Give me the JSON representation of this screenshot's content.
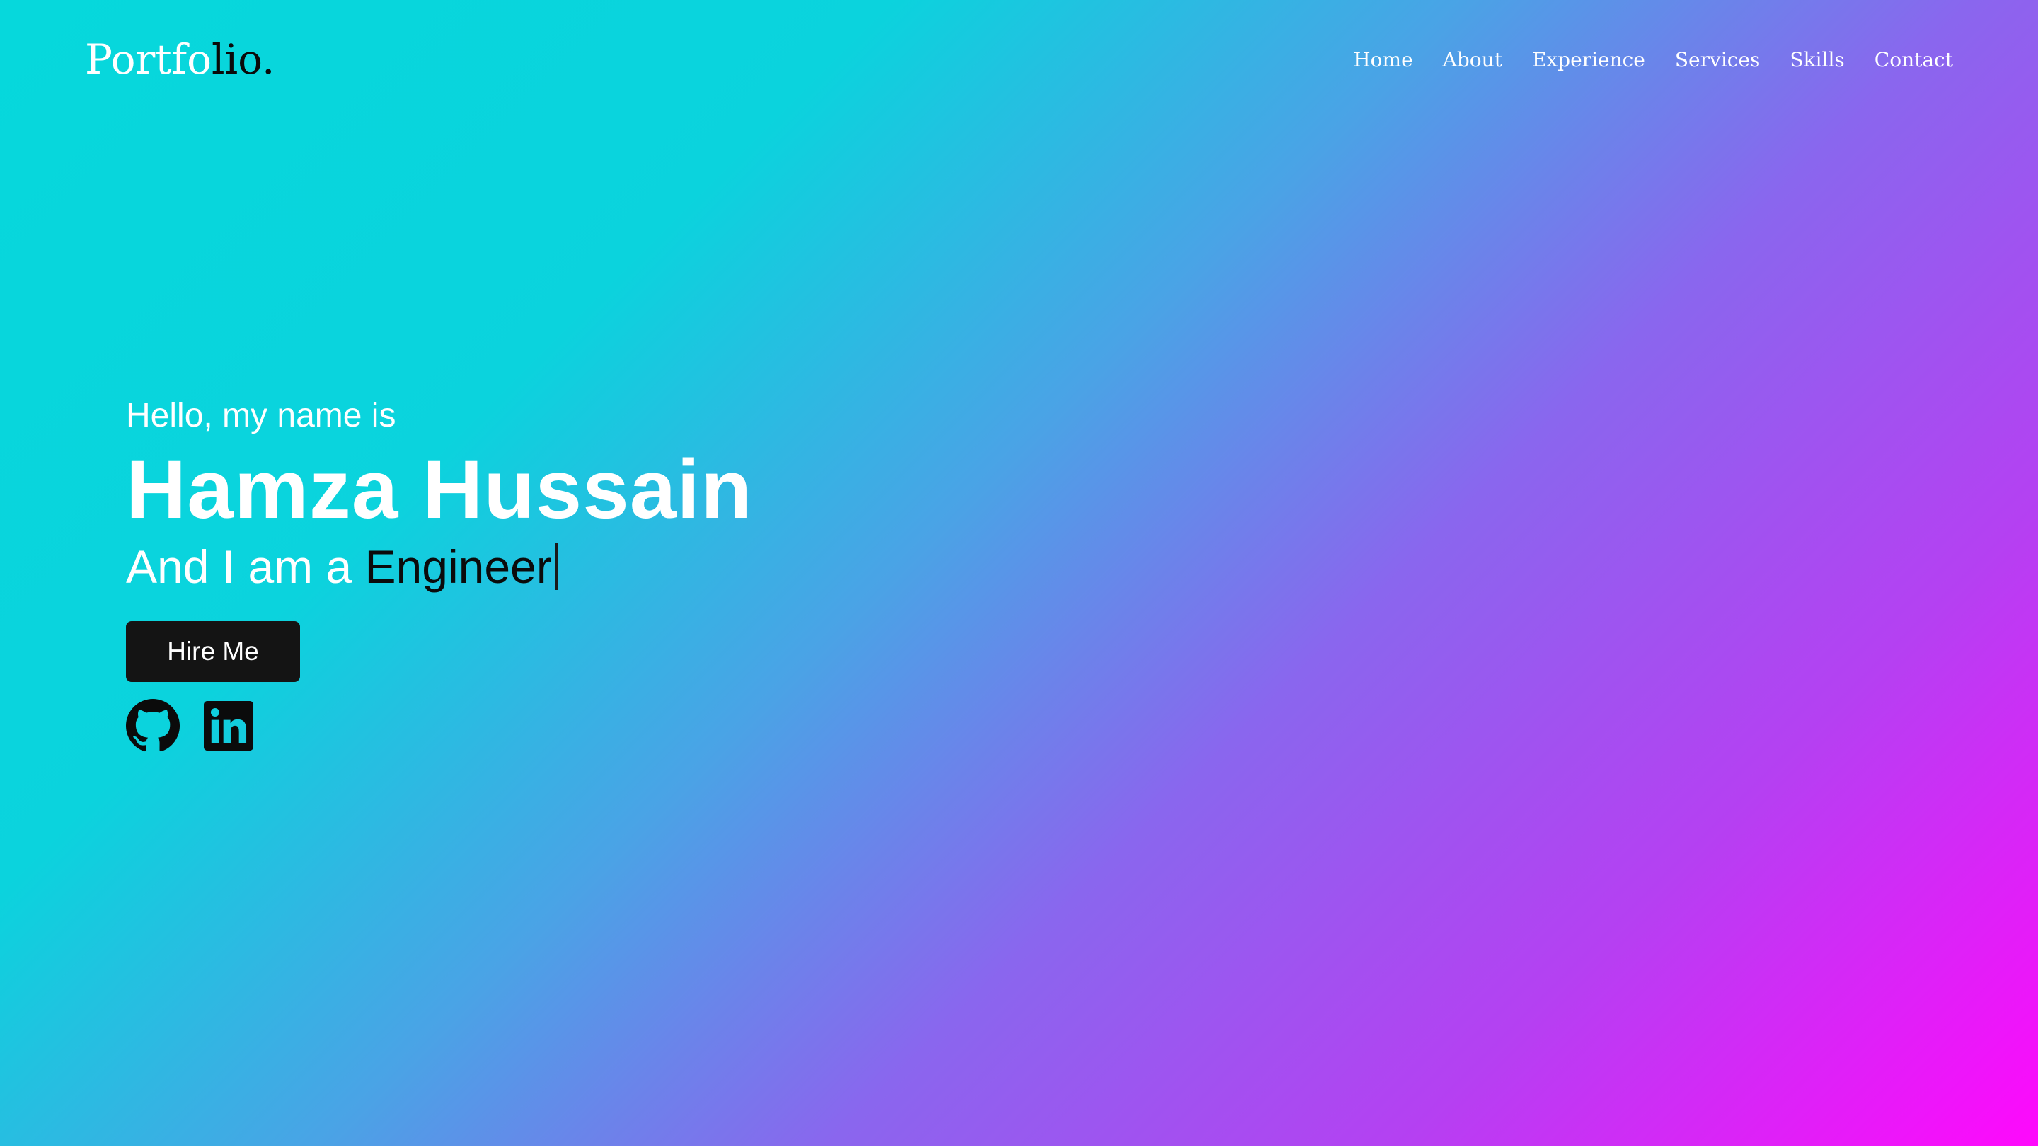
{
  "header": {
    "logo": {
      "part1": "Portfo",
      "part2": "lio."
    },
    "nav": [
      {
        "label": "Home"
      },
      {
        "label": "About"
      },
      {
        "label": "Experience"
      },
      {
        "label": "Services"
      },
      {
        "label": "Skills"
      },
      {
        "label": "Contact"
      }
    ]
  },
  "hero": {
    "greeting": "Hello, my name is",
    "name": "Hamza Hussain",
    "role_prefix": "And I am a ",
    "role_word": "Engineer",
    "hire_button": "Hire Me",
    "socials": [
      {
        "icon": "github-icon"
      },
      {
        "icon": "linkedin-icon"
      }
    ]
  },
  "colors": {
    "gradient_start": "#06d8dc",
    "gradient_end": "#ff08fc",
    "button_bg": "#141414",
    "text_light": "#ffffff",
    "text_dark": "#0b0b0b"
  }
}
